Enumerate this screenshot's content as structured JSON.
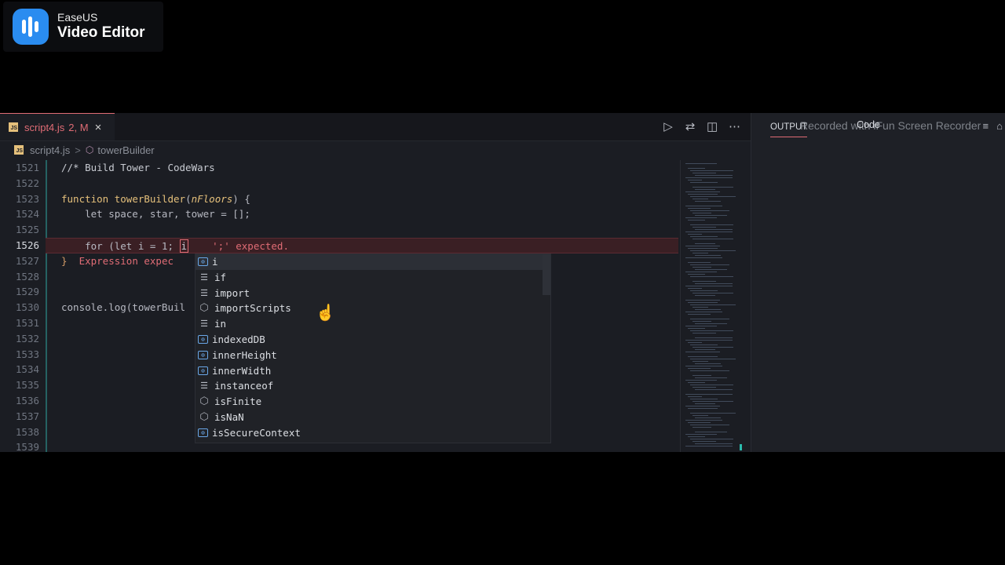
{
  "watermark": {
    "brand": "EaseUS",
    "product": "Video Editor"
  },
  "tab": {
    "badge": "JS",
    "filename": "script4.js",
    "status": "2, M",
    "close_icon": "×"
  },
  "editor_actions": [
    "run-icon",
    "compare-icon",
    "split-editor-icon",
    "more-icon"
  ],
  "breadcrumb": {
    "file": "script4.js",
    "separator": ">",
    "symbol": "towerBuilder"
  },
  "line_numbers": [
    "1521",
    "1522",
    "1523",
    "1524",
    "1525",
    "1526",
    "1527",
    "1528",
    "1529",
    "1530",
    "1531",
    "1532",
    "1533",
    "1534",
    "1535",
    "1536",
    "1537",
    "1538",
    "1539"
  ],
  "active_line": "1526",
  "code": {
    "l1521": "//* Build Tower - CodeWars",
    "l1523_kw": "function",
    "l1523_fn": "towerBuilder",
    "l1523_open": "(",
    "l1523_param": "nFloors",
    "l1523_close": ") {",
    "l1524": "    let space, star, tower = [];",
    "l1526_a": "    for (let i = 1; ",
    "l1526_cursor": "i",
    "l1526_err": "    ';' expected.",
    "l1527_brace": "}",
    "l1527_err": "  Expression expec",
    "l1530": "console.log(towerBuil"
  },
  "suggestions": [
    {
      "label": "i",
      "kind": "variable",
      "selected": true
    },
    {
      "label": "if",
      "kind": "keyword"
    },
    {
      "label": "import",
      "kind": "keyword"
    },
    {
      "label": "importScripts",
      "kind": "module"
    },
    {
      "label": "in",
      "kind": "keyword"
    },
    {
      "label": "indexedDB",
      "kind": "variable"
    },
    {
      "label": "innerHeight",
      "kind": "variable"
    },
    {
      "label": "innerWidth",
      "kind": "variable"
    },
    {
      "label": "instanceof",
      "kind": "keyword"
    },
    {
      "label": "isFinite",
      "kind": "module"
    },
    {
      "label": "isNaN",
      "kind": "module"
    },
    {
      "label": "isSecureContext",
      "kind": "variable"
    }
  ],
  "panel": {
    "tab_label": "OUTPUT",
    "overlay_text": "Recorded with iFun Screen Recorder",
    "channel": "Code",
    "icons": [
      "clear-output-icon",
      "lock-icon"
    ]
  }
}
